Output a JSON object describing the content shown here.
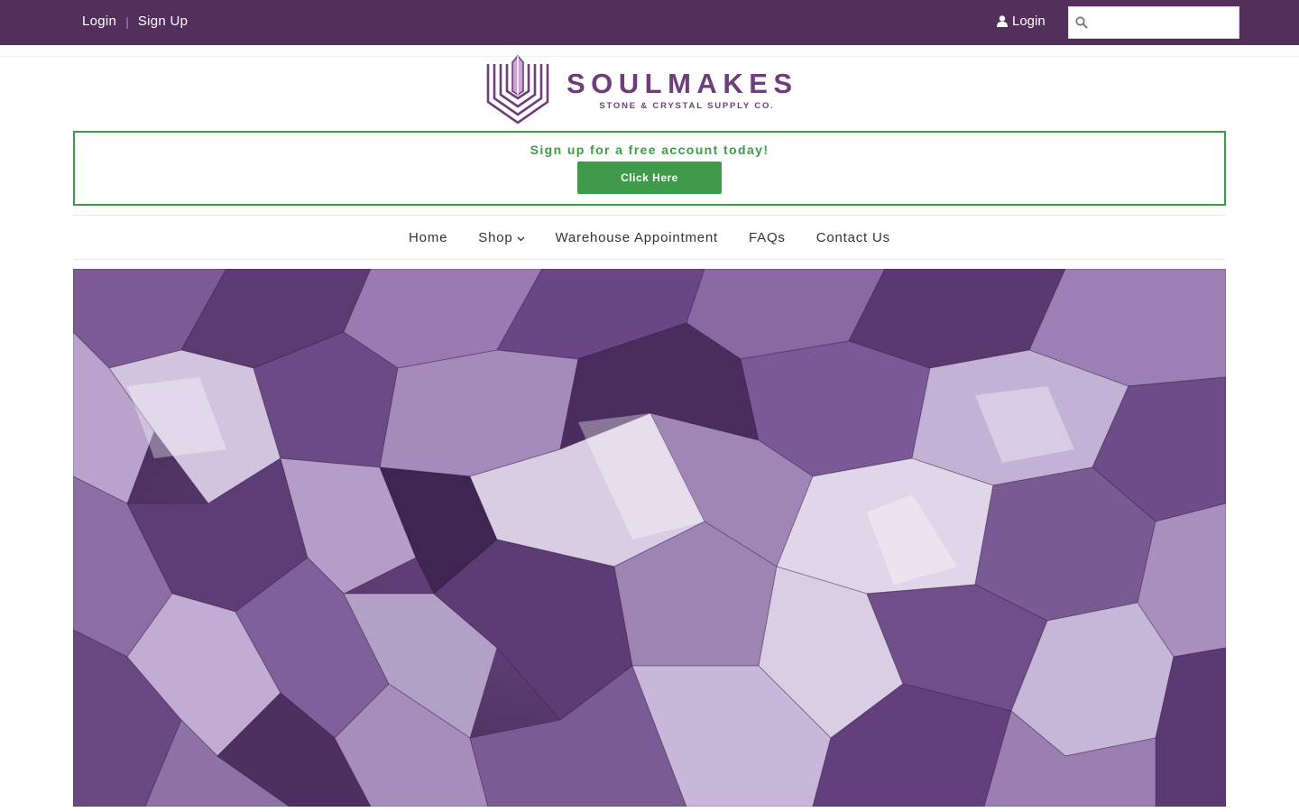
{
  "topbar": {
    "login_label": "Login",
    "separator": "|",
    "signup_label": "Sign Up",
    "account_login_label": "Login",
    "search_placeholder": ""
  },
  "logo": {
    "brand": "SOULMAKES",
    "tagline": "STONE & CRYSTAL SUPPLY CO."
  },
  "promo": {
    "message": "Sign up for a free account today!",
    "button_label": "Click Here"
  },
  "nav": {
    "items": [
      {
        "label": "Home"
      },
      {
        "label": "Shop"
      },
      {
        "label": "Warehouse Appointment"
      },
      {
        "label": "FAQs"
      },
      {
        "label": "Contact Us"
      }
    ]
  },
  "icons": {
    "user": "user-icon",
    "search": "search-icon",
    "dropdown": "chevron-down-icon"
  },
  "colors": {
    "topbar": "#532f5c",
    "brand": "#6f3d7c",
    "promo_green": "#3f9b4a"
  }
}
